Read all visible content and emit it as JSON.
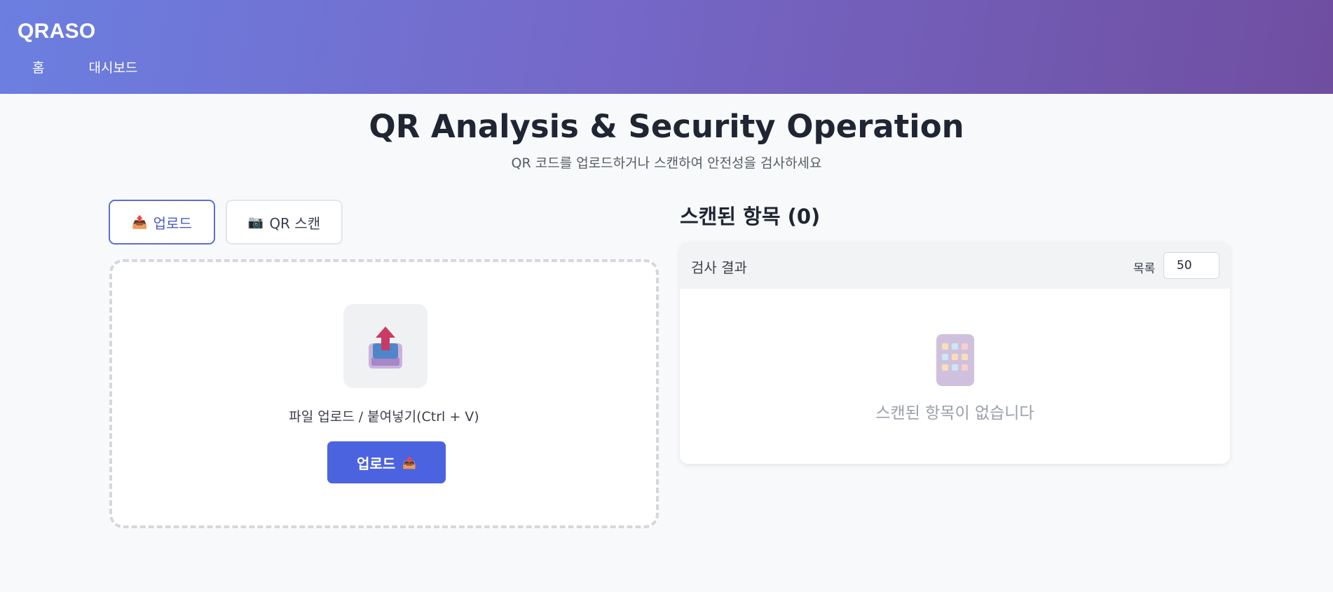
{
  "header": {
    "brand": "QRASO",
    "nav": [
      {
        "label": "홈"
      },
      {
        "label": "대시보드"
      }
    ]
  },
  "hero": {
    "title": "QR Analysis & Security Operation",
    "subtitle": "QR 코드를 업로드하거나 스캔하여 안전성을 검사하세요"
  },
  "tabs": [
    {
      "label": "업로드",
      "icon": "📤",
      "active": true
    },
    {
      "label": "QR 스캔",
      "icon": "📷",
      "active": false
    }
  ],
  "upload": {
    "instruction": "파일 업로드 / 붙여넣기(Ctrl + V)",
    "button_label": "업로드",
    "button_icon": "📤"
  },
  "results": {
    "title": "스캔된 항목 (0)",
    "header_label": "검사 결과",
    "list_label": "목록",
    "limit_value": "50",
    "empty_text": "스캔된 항목이 없습니다"
  },
  "colors": {
    "header_gradient_start": "#6b7fe0",
    "header_gradient_end": "#6f4ea0",
    "accent": "#4c63e0"
  }
}
